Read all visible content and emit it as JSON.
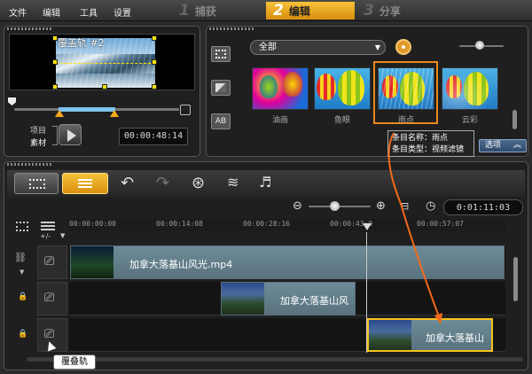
{
  "menu": {
    "file": "文件",
    "edit": "编辑",
    "tools": "工具",
    "settings": "设置"
  },
  "steps": [
    {
      "num": "1",
      "label": "捕获"
    },
    {
      "num": "2",
      "label": "编辑"
    },
    {
      "num": "3",
      "label": "分享"
    }
  ],
  "preview": {
    "overlay_label": "覆盖轨 #2",
    "project_label": "项目",
    "clip_label": "素材",
    "timecode": "00:00:48:14"
  },
  "library": {
    "category_selected": "全部",
    "thumbnails": [
      {
        "label": "油画"
      },
      {
        "label": "鱼眼"
      },
      {
        "label": "雨点"
      },
      {
        "label": "云彩"
      }
    ],
    "options_label": "选项",
    "side_ab_label": "AB"
  },
  "tooltip": {
    "name_line": "条目名称：雨点",
    "type_line": "条目类型：视频滤镜"
  },
  "timeline": {
    "timecode": "0:01:11:03",
    "ruler": [
      "00:00:00:00",
      "00:00:14:08",
      "00:00:28:16",
      "00:00:43:0",
      "00:00:57:07"
    ],
    "clips": [
      {
        "title": "加拿大落基山风光.mp4"
      },
      {
        "title": "加拿大落基山风"
      },
      {
        "title": "加拿大落基山"
      }
    ],
    "callout": "覆叠轨",
    "plusminus": "+/-"
  },
  "colors": {
    "accent": "#f4a81b",
    "arrow": "#f36a1a",
    "highlight_border": "#e8891a"
  }
}
